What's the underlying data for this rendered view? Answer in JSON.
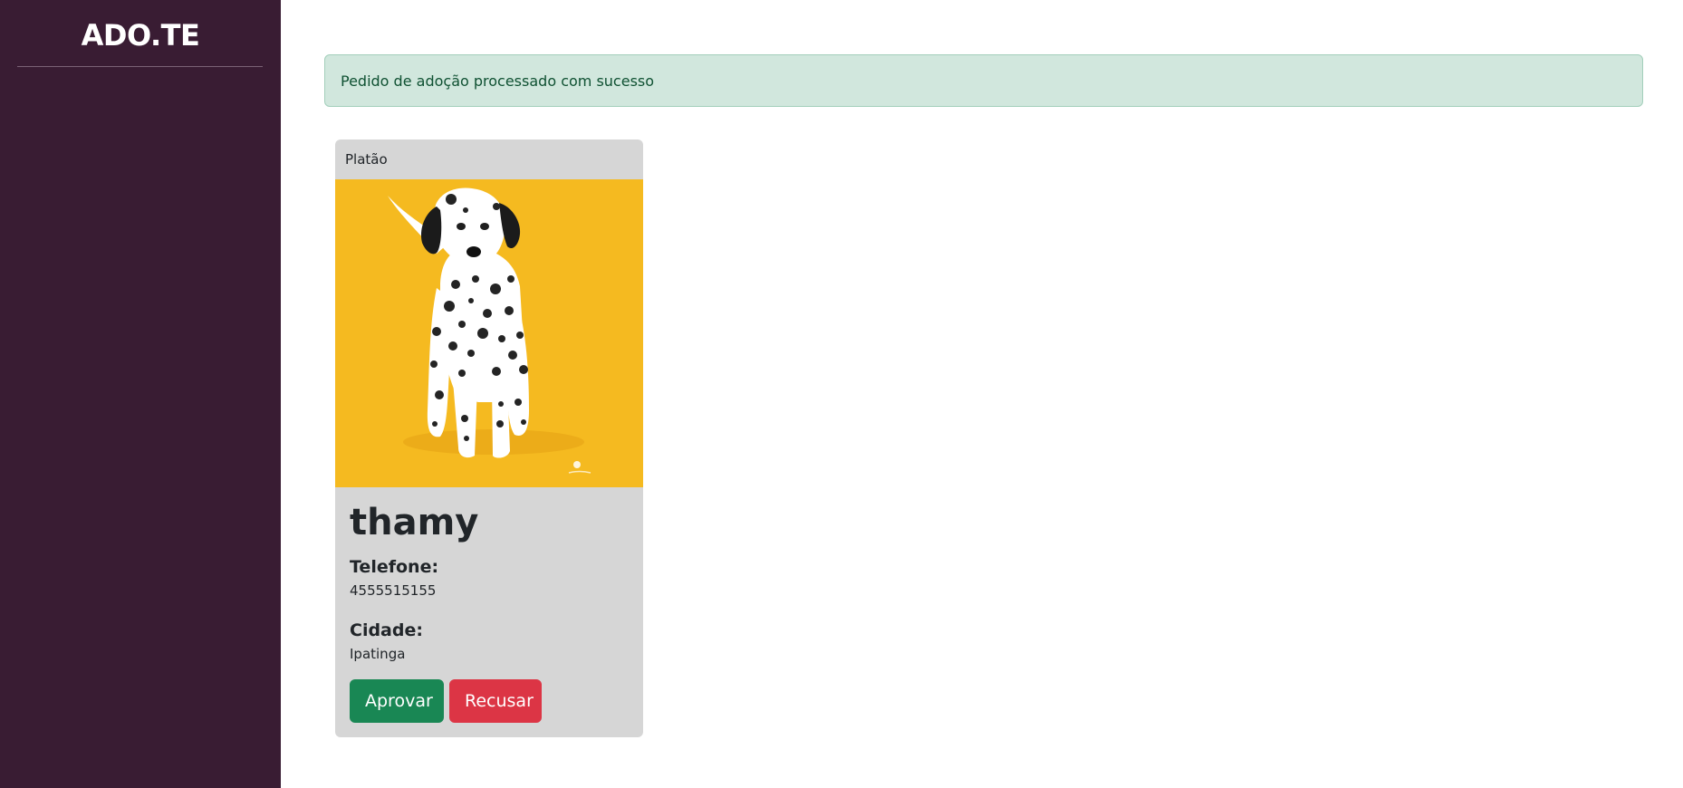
{
  "sidebar": {
    "brand": "ADO.TE",
    "background_color": "#391c33"
  },
  "alert": {
    "message": "Pedido de adoção processado com sucesso",
    "color": "#0f5132",
    "background_color": "#d1e7dd"
  },
  "adoption_request": {
    "pet_name": "Platão",
    "pet_photo_icon": "dalmatian-puppy-photo",
    "adopter_name": "thamy",
    "phone_label": "Telefone:",
    "phone_value": "4555515155",
    "city_label": "Cidade:",
    "city_value": "Ipatinga",
    "approve_label": "Aprovar",
    "reject_label": "Recusar",
    "approve_color": "#198754",
    "reject_color": "#dc3545"
  }
}
